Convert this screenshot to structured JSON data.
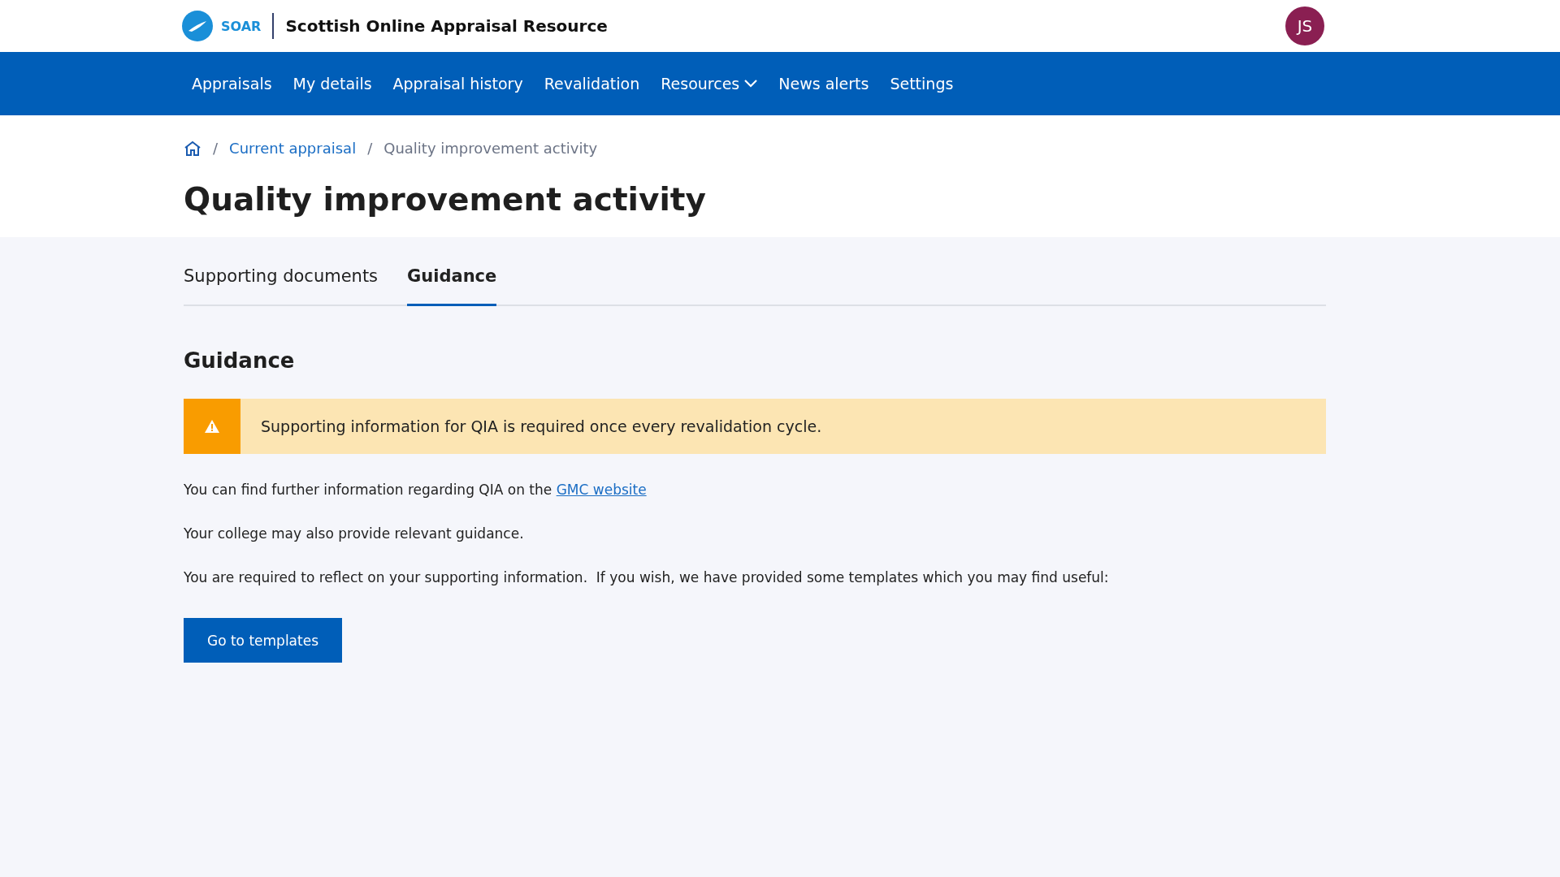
{
  "header": {
    "logo_text": "SOAR",
    "title": "Scottish Online Appraisal Resource",
    "avatar": "JS"
  },
  "nav": [
    {
      "label": "Appraisals",
      "has_menu": false
    },
    {
      "label": "My details",
      "has_menu": false
    },
    {
      "label": "Appraisal history",
      "has_menu": false
    },
    {
      "label": "Revalidation",
      "has_menu": false
    },
    {
      "label": "Resources",
      "has_menu": true
    },
    {
      "label": "News alerts",
      "has_menu": false
    },
    {
      "label": "Settings",
      "has_menu": false
    }
  ],
  "breadcrumb": [
    {
      "separator": "/",
      "label": "Current appraisal",
      "kind": "link"
    },
    {
      "separator": "/",
      "label": "Quality improvement activity",
      "kind": "current"
    }
  ],
  "page_title": "Quality improvement activity",
  "tabs": [
    {
      "label": "Supporting documents",
      "selected": false
    },
    {
      "label": "Guidance",
      "selected": true
    }
  ],
  "section_title": "Guidance",
  "alert": {
    "kind": "warning",
    "text": "Supporting information for QIA is required once every revalidation cycle."
  },
  "paragraphs": [
    {
      "text": "You can find further information regarding QIA on the ",
      "link": "GMC website"
    },
    {
      "text": "Your college may also provide relevant guidance."
    },
    {
      "text": "You are required to reflect on your supporting information.  If you wish, we have provided some templates which you may find useful:"
    }
  ],
  "button": "Go to templates"
}
